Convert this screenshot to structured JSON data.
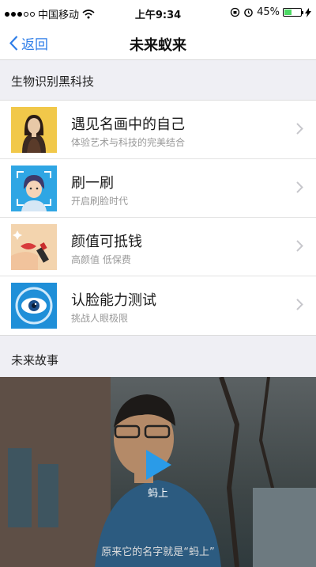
{
  "status_bar": {
    "carrier": "中国移动",
    "time": "上午9:34",
    "battery": "45%",
    "battery_level": 0.45
  },
  "nav": {
    "back_label": "返回",
    "title": "未来蚁来"
  },
  "section1": {
    "title": "生物识别黑科技"
  },
  "items": [
    {
      "title": "遇见名画中的自己",
      "subtitle": "体验艺术与科技的完美结合",
      "icon": "portrait-painting-icon"
    },
    {
      "title": "刷一刷",
      "subtitle": "开启刷脸时代",
      "icon": "face-scan-icon"
    },
    {
      "title": "颜值可抵钱",
      "subtitle": "高颜值 低保费",
      "icon": "lipstick-icon"
    },
    {
      "title": "认脸能力测试",
      "subtitle": "挑战人眼极限",
      "icon": "eye-icon"
    }
  ],
  "section2": {
    "title": "未来故事"
  },
  "video": {
    "play_label": "蚂上",
    "subtitle": "原来它的名字就是“蚂上”"
  },
  "colors": {
    "accent": "#2f7ee8",
    "background": "#efeff4"
  }
}
